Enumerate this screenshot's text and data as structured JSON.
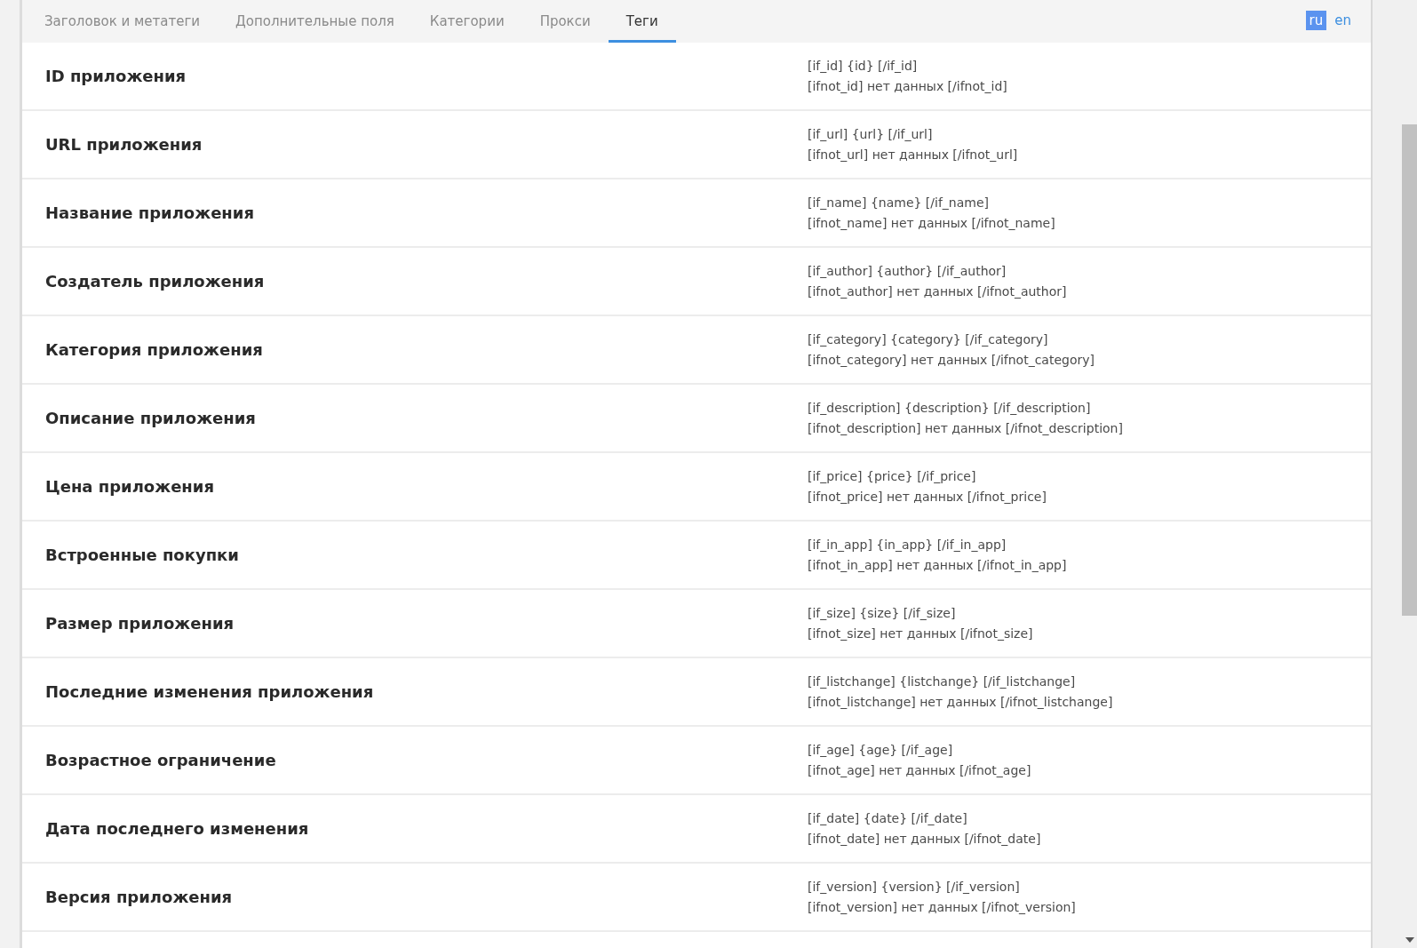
{
  "tabs": [
    {
      "label": "Заголовок и метатеги",
      "selected": false
    },
    {
      "label": "Дополнительные поля",
      "selected": false
    },
    {
      "label": "Категории",
      "selected": false
    },
    {
      "label": "Прокси",
      "selected": false
    },
    {
      "label": "Теги",
      "selected": true
    }
  ],
  "languages": [
    {
      "label": "ru",
      "selected": true
    },
    {
      "label": "en",
      "selected": false
    }
  ],
  "rows": [
    {
      "name": "ID приложения",
      "tag_if": "[if_id] {id} [/if_id]",
      "tag_ifnot": "[ifnot_id] нет данных [/ifnot_id]"
    },
    {
      "name": "URL приложения",
      "tag_if": "[if_url] {url} [/if_url]",
      "tag_ifnot": "[ifnot_url] нет данных [/ifnot_url]"
    },
    {
      "name": "Название приложения",
      "tag_if": "[if_name] {name} [/if_name]",
      "tag_ifnot": "[ifnot_name] нет данных [/ifnot_name]"
    },
    {
      "name": "Создатель приложения",
      "tag_if": "[if_author] {author} [/if_author]",
      "tag_ifnot": "[ifnot_author] нет данных [/ifnot_author]"
    },
    {
      "name": "Категория приложения",
      "tag_if": "[if_category] {category} [/if_category]",
      "tag_ifnot": "[ifnot_category] нет данных [/ifnot_category]"
    },
    {
      "name": "Описание приложения",
      "tag_if": "[if_description] {description} [/if_description]",
      "tag_ifnot": "[ifnot_description] нет данных [/ifnot_description]"
    },
    {
      "name": "Цена приложения",
      "tag_if": "[if_price] {price} [/if_price]",
      "tag_ifnot": "[ifnot_price] нет данных [/ifnot_price]"
    },
    {
      "name": "Встроенные покупки",
      "tag_if": "[if_in_app] {in_app} [/if_in_app]",
      "tag_ifnot": "[ifnot_in_app] нет данных [/ifnot_in_app]"
    },
    {
      "name": "Размер приложения",
      "tag_if": "[if_size] {size} [/if_size]",
      "tag_ifnot": "[ifnot_size] нет данных [/ifnot_size]"
    },
    {
      "name": "Последние изменения приложения",
      "tag_if": "[if_listchange] {listchange} [/if_listchange]",
      "tag_ifnot": "[ifnot_listchange] нет данных [/ifnot_listchange]"
    },
    {
      "name": "Возрастное ограничение",
      "tag_if": "[if_age] {age} [/if_age]",
      "tag_ifnot": "[ifnot_age] нет данных [/ifnot_age]"
    },
    {
      "name": "Дата последнего изменения",
      "tag_if": "[if_date] {date} [/if_date]",
      "tag_ifnot": "[ifnot_date] нет данных [/ifnot_date]"
    },
    {
      "name": "Версия приложения",
      "tag_if": "[if_version] {version} [/if_version]",
      "tag_ifnot": "[ifnot_version] нет данных [/ifnot_version]"
    }
  ]
}
